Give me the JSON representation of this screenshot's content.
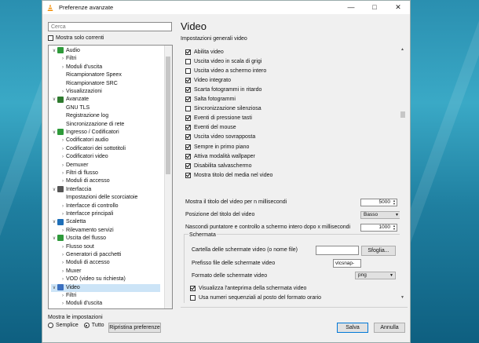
{
  "window": {
    "title": "Preferenze avanzate"
  },
  "left": {
    "search_placeholder": "Cerca",
    "show_current_only": "Mostra solo correnti",
    "tree": [
      {
        "label": "Audio",
        "level": 0,
        "arrow": "v",
        "icon": "audio"
      },
      {
        "label": "Filtri",
        "level": 1,
        "arrow": ">"
      },
      {
        "label": "Moduli d'uscita",
        "level": 1,
        "arrow": ">"
      },
      {
        "label": "Ricampionatore Speex",
        "level": 1,
        "arrow": ""
      },
      {
        "label": "Ricampionatore SRC",
        "level": 1,
        "arrow": ""
      },
      {
        "label": "Visualizzazioni",
        "level": 1,
        "arrow": ">"
      },
      {
        "label": "Avanzate",
        "level": 0,
        "arrow": "v",
        "icon": "advanced"
      },
      {
        "label": "GNU TLS",
        "level": 1,
        "arrow": ""
      },
      {
        "label": "Registrazione log",
        "level": 1,
        "arrow": ""
      },
      {
        "label": "Sincronizzazione di rete",
        "level": 1,
        "arrow": ""
      },
      {
        "label": "Ingresso / Codificatori",
        "level": 0,
        "arrow": "v",
        "icon": "input"
      },
      {
        "label": "Codificatori audio",
        "level": 1,
        "arrow": ">"
      },
      {
        "label": "Codificatori dei sottotitoli",
        "level": 1,
        "arrow": ">"
      },
      {
        "label": "Codificatori video",
        "level": 1,
        "arrow": ">"
      },
      {
        "label": "Demuxer",
        "level": 1,
        "arrow": ">"
      },
      {
        "label": "Filtri di flusso",
        "level": 1,
        "arrow": ">"
      },
      {
        "label": "Moduli di accesso",
        "level": 1,
        "arrow": ">"
      },
      {
        "label": "Interfaccia",
        "level": 0,
        "arrow": "v",
        "icon": "interface"
      },
      {
        "label": "Impostazioni delle scorciatoie",
        "level": 1,
        "arrow": ""
      },
      {
        "label": "Interfacce di controllo",
        "level": 1,
        "arrow": ">"
      },
      {
        "label": "Interfacce principali",
        "level": 1,
        "arrow": ">"
      },
      {
        "label": "Scaletta",
        "level": 0,
        "arrow": "v",
        "icon": "playlist"
      },
      {
        "label": "Rilevamento servizi",
        "level": 1,
        "arrow": ">"
      },
      {
        "label": "Uscita del flusso",
        "level": 0,
        "arrow": "v",
        "icon": "stream"
      },
      {
        "label": "Flusso sout",
        "level": 1,
        "arrow": ">"
      },
      {
        "label": "Generatori di pacchetti",
        "level": 1,
        "arrow": ">"
      },
      {
        "label": "Moduli di accesso",
        "level": 1,
        "arrow": ">"
      },
      {
        "label": "Muxer",
        "level": 1,
        "arrow": ">"
      },
      {
        "label": "VOD (video su richiesta)",
        "level": 1,
        "arrow": ">"
      },
      {
        "label": "Video",
        "level": 0,
        "arrow": "v",
        "icon": "video",
        "selected": true
      },
      {
        "label": "Filtri",
        "level": 1,
        "arrow": ">"
      },
      {
        "label": "Moduli d'uscita",
        "level": 1,
        "arrow": ">"
      }
    ],
    "show_settings_label": "Mostra le impostazioni",
    "radio_simple": "Semplice",
    "radio_all": "Tutto",
    "reset_button": "Ripristina preferenze"
  },
  "right": {
    "title": "Video",
    "subtitle": "Impostazioni generali  video",
    "options": [
      {
        "label": "Abilita video",
        "checked": true
      },
      {
        "label": "Uscita video in scala di grigi",
        "checked": false
      },
      {
        "label": "Uscita video a schermo intero",
        "checked": false
      },
      {
        "label": "Video integrato",
        "checked": true
      },
      {
        "label": "Scarta fotogrammi in ritardo",
        "checked": true
      },
      {
        "label": "Salta fotogrammi",
        "checked": true
      },
      {
        "label": "Sincronizzazione silenziosa",
        "checked": false
      },
      {
        "label": "Eventi di pressione tasti",
        "checked": true
      },
      {
        "label": "Eventi del mouse",
        "checked": true
      },
      {
        "label": "Uscita video sovrapposta",
        "checked": true
      },
      {
        "label": "Sempre in primo piano",
        "checked": true
      },
      {
        "label": "Attiva modalità wallpaper",
        "checked": true
      },
      {
        "label": "Disabilita salvaschermo",
        "checked": true
      },
      {
        "label": "Mostra titolo del media nel video",
        "checked": true
      }
    ],
    "title_ms_label": "Mostra il titolo del video per n millisecondi",
    "title_ms_value": "5000",
    "title_pos_label": "Posizione del titolo del video",
    "title_pos_value": "Basso",
    "hide_cursor_label": "Nascondi puntatore e controllo a schermo intero dopo x millisecondi",
    "hide_cursor_value": "1000",
    "snapshot_group": "Schermata",
    "snap_dir_label": "Cartella delle schermate video (o nome file)",
    "snap_dir_value": "",
    "browse_button": "Sfoglia...",
    "snap_prefix_label": "Prefisso file delle schermate video",
    "snap_prefix_value": "vlcsnap-",
    "snap_format_label": "Formato delle schermate video",
    "snap_format_value": "png",
    "snap_preview_label": "Visualizza l'anteprima della schermata video",
    "snap_preview_checked": true,
    "snap_seq_label": "Usa numeri sequenziali al posto del formato orario",
    "snap_seq_checked": false
  },
  "footer": {
    "save": "Salva",
    "cancel": "Annulla"
  }
}
